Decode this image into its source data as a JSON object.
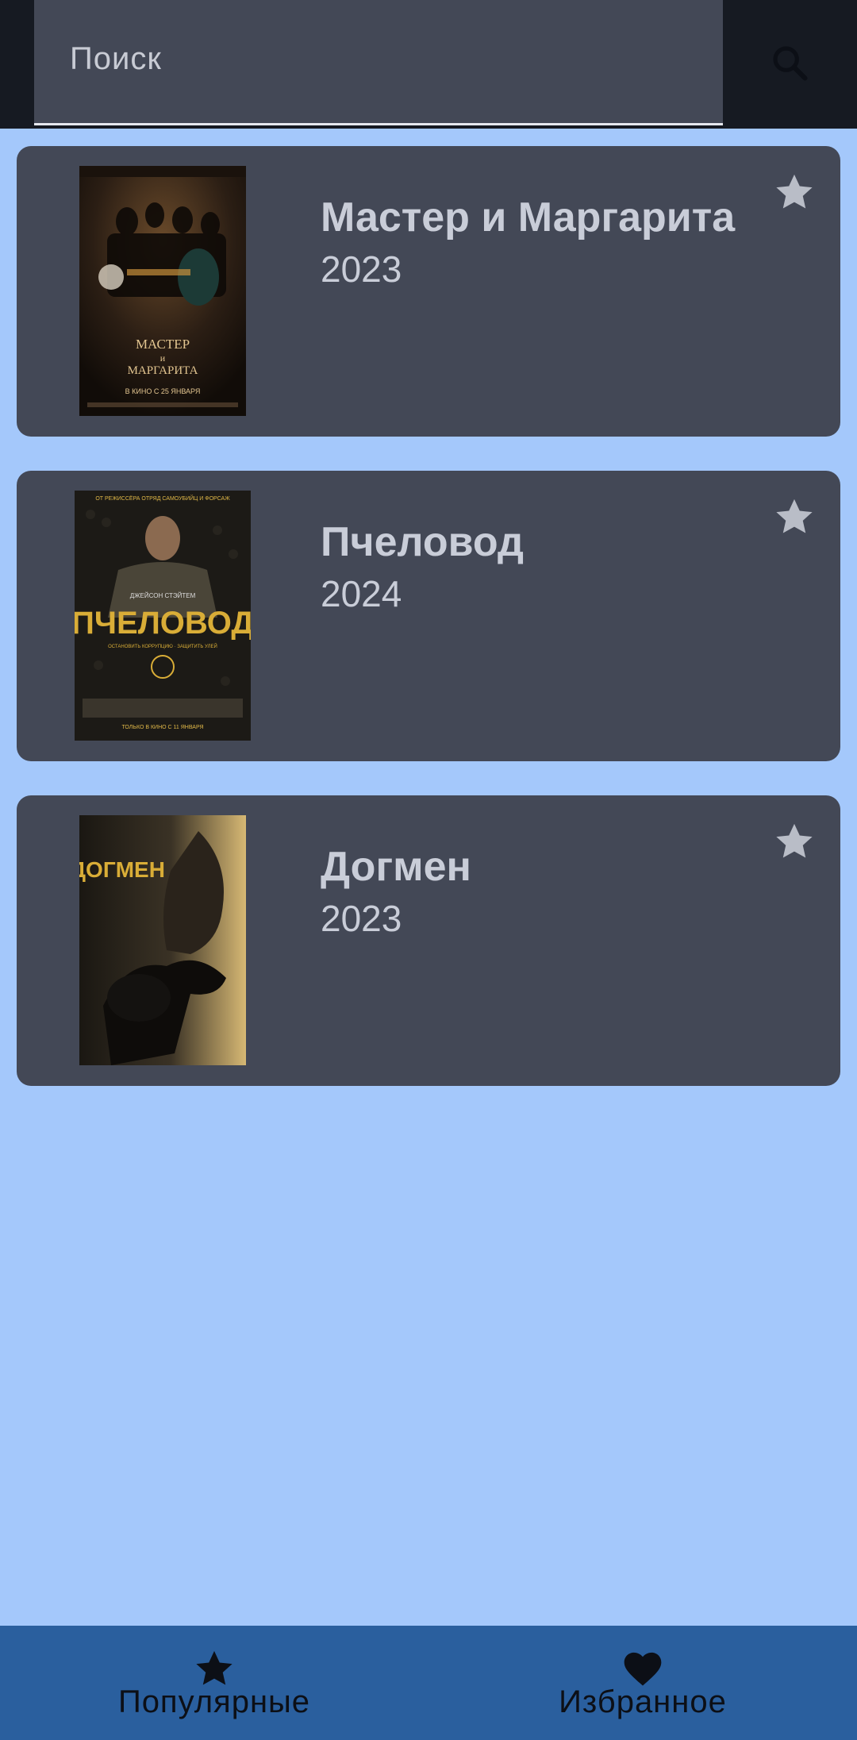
{
  "search": {
    "placeholder": "Поиск",
    "value": ""
  },
  "movies": [
    {
      "title": "Мастер и Маргарита",
      "year": "2023",
      "poster_caption": "МАСТЕР И МАРГАРИТА",
      "poster_sub": "В КИНО С 25 ЯНВАРЯ"
    },
    {
      "title": "Пчеловод",
      "year": "2024",
      "poster_caption": "ПЧЕЛОВОД",
      "poster_sub": "ТОЛЬКО В КИНО С 11 ЯНВАРЯ"
    },
    {
      "title": "Догмен",
      "year": "2023",
      "poster_caption": "ДОГМЕН",
      "poster_sub": ""
    }
  ],
  "nav": {
    "popular_label": "Популярные",
    "favorites_label": "Избранное"
  },
  "colors": {
    "background": "#a4c8fb",
    "card": "#434856",
    "bottom_nav": "#2a5f9e",
    "topbar": "#161a22"
  }
}
